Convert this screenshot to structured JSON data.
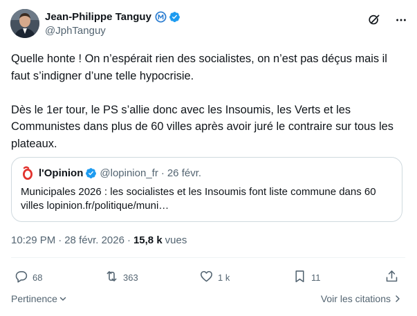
{
  "author": {
    "display_name": "Jean-Philippe Tanguy",
    "handle": "@JphTanguy"
  },
  "tweet": {
    "text": "Quelle honte ! On n’espérait rien des socialistes, on n’est pas déçus mais il faut s’indigner d’une telle hypocrisie.\n\nDès le 1er tour, le PS s’allie donc avec les Insoumis, les Verts et les Communistes dans plus de 60 villes après avoir juré le contraire sur tous les plateaux."
  },
  "quote": {
    "display_name": "l'Opinion",
    "handle": "@lopinion_fr",
    "separator": "·",
    "date": "26 févr.",
    "text": "Municipales 2026 : les socialistes et les Insoumis font liste commune dans 60 villes lopinion.fr/politique/muni…"
  },
  "meta": {
    "time": "10:29 PM",
    "separator": "·",
    "date": "28 févr. 2026",
    "separator2": "·",
    "views_count": "15,8 k",
    "views_label": "vues"
  },
  "actions": {
    "replies": "68",
    "reposts": "363",
    "likes": "1 k",
    "bookmarks": "11"
  },
  "footer": {
    "relevance_label": "Pertinence",
    "quotes_label": "Voir les citations"
  },
  "colors": {
    "verified_blue": "#1d9bf0",
    "affiliation_blue": "#2f7fd1",
    "text_primary": "#0f1419",
    "text_secondary": "#536471",
    "border": "#cfd9de",
    "opinion_red": "#e2332e"
  },
  "icons": {
    "header_grok": "grok-icon",
    "header_more": "more-icon",
    "reply": "reply-icon",
    "repost": "repost-icon",
    "like": "like-icon",
    "bookmark": "bookmark-icon",
    "share": "share-icon"
  }
}
